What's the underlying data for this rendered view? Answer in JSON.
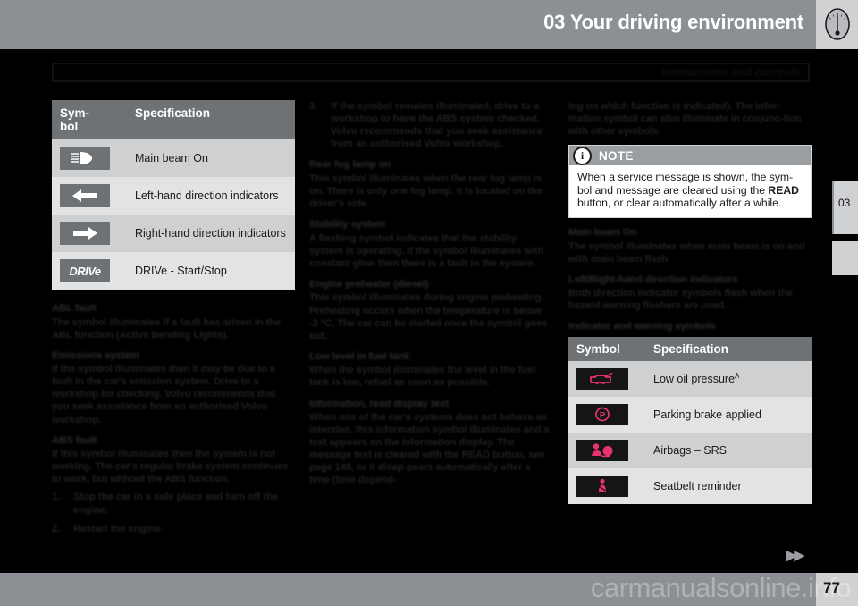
{
  "header": {
    "title": "03 Your driving environment",
    "subtitle": "Instruments and controls",
    "gauge_icon": "speedometer-icon",
    "chapter_tab": "03"
  },
  "left_column": {
    "table": {
      "headers": {
        "symbol": "Sym-\nbol",
        "specification": "Specification"
      },
      "rows": [
        {
          "icon": "main-beam-icon",
          "spec": "Main beam On"
        },
        {
          "icon": "left-arrow-icon",
          "spec": "Left-hand direction indicators"
        },
        {
          "icon": "right-arrow-icon",
          "spec": "Right-hand direction indicators"
        },
        {
          "icon": "drive-text-icon",
          "spec": "DRIVe - Start/Stop"
        }
      ]
    },
    "sections": [
      {
        "heading": "ABL fault",
        "body": "The symbol illuminates if a fault has arisen in the ABL function (Active Bending Lights)."
      },
      {
        "heading": "Emissions system",
        "body": "If the symbol illuminates then it may be due to a fault in the car's emission system. Drive to a workshop for checking. Volvo recommends that you seek assistance from an authorised Volvo workshop."
      },
      {
        "heading": "ABS fault",
        "body": "If this symbol illuminates then the system is not working. The car's regular brake system continues to work, but without the ABS function."
      }
    ],
    "steps": [
      {
        "num": "1.",
        "text": "Stop the car in a safe place and turn off the engine."
      },
      {
        "num": "2.",
        "text": "Restart the engine."
      }
    ]
  },
  "middle_column": {
    "continued_step": {
      "num": "3.",
      "text": "If the symbol remains illuminated, drive to a workshop to have the ABS system checked. Volvo recommends that you seek assistance from an authorised Volvo workshop."
    },
    "sections": [
      {
        "heading": "Rear fog lamp on",
        "body": "This symbol illuminates when the rear fog lamp is on. There is only one fog lamp. It is located on the driver's side."
      },
      {
        "heading": "Stability system",
        "body": "A flashing symbol indicates that the stability system is operating. If the symbol illuminates with constant glow then there is a fault in the system."
      },
      {
        "heading": "Engine preheater (diesel)",
        "body": "This symbol illuminates during engine preheating. Preheating occurs when the temperature is below -2 °C. The car can be started once the symbol goes out."
      },
      {
        "heading": "Low level in fuel tank",
        "body": "When the symbol illuminates the level in the fuel tank is low, refuel as soon as possible."
      },
      {
        "heading": "Information, read display text",
        "body": "When one of the car's systems does not behave as intended, this information symbol illuminates and a text appears on the information display. The message text is cleared with the READ button, see page 148, or it disap-pears automatically after a time (time depend-"
      }
    ]
  },
  "right_column": {
    "continued_text": "ing on which function is indicated). The infor-mation symbol can also illuminate in conjunc-tion with other symbols.",
    "note": {
      "icon": "info-icon",
      "title": "NOTE",
      "text_1": "When a service message is shown, the sym-bol and message are cleared using the ",
      "text_bold": "READ",
      "text_2": " button, or clear automatically after a while."
    },
    "sections": [
      {
        "heading": "Main beam On",
        "body": "The symbol illuminates when main beam is on and with main beam flash"
      },
      {
        "heading": "Left/Right-hand direction indicators",
        "body": "Both direction indicator symbols flash when the hazard warning flashers are used."
      }
    ],
    "table_heading": "Indicator and warning symbols",
    "table": {
      "headers": {
        "symbol": "Symbol",
        "specification": "Specification"
      },
      "rows": [
        {
          "icon": "oil-can-icon",
          "spec": "Low oil pressure",
          "sup": "A"
        },
        {
          "icon": "parking-brake-icon",
          "spec": "Parking brake applied",
          "sup": ""
        },
        {
          "icon": "airbag-srs-icon",
          "spec": "Airbags – SRS",
          "sup": ""
        },
        {
          "icon": "seatbelt-icon",
          "spec": "Seatbelt reminder",
          "sup": ""
        }
      ]
    }
  },
  "footer": {
    "page_number": "77",
    "next_marker": "▶▶",
    "watermark": "carmanualsonline.info"
  },
  "colors": {
    "header_band": "#8c9095",
    "table_header": "#6e7275",
    "row_alt_dark": "#cfd0d2",
    "row_alt_light": "#e2e3e4",
    "warning_icon": "#e8336e",
    "page_bg": "#000000"
  }
}
